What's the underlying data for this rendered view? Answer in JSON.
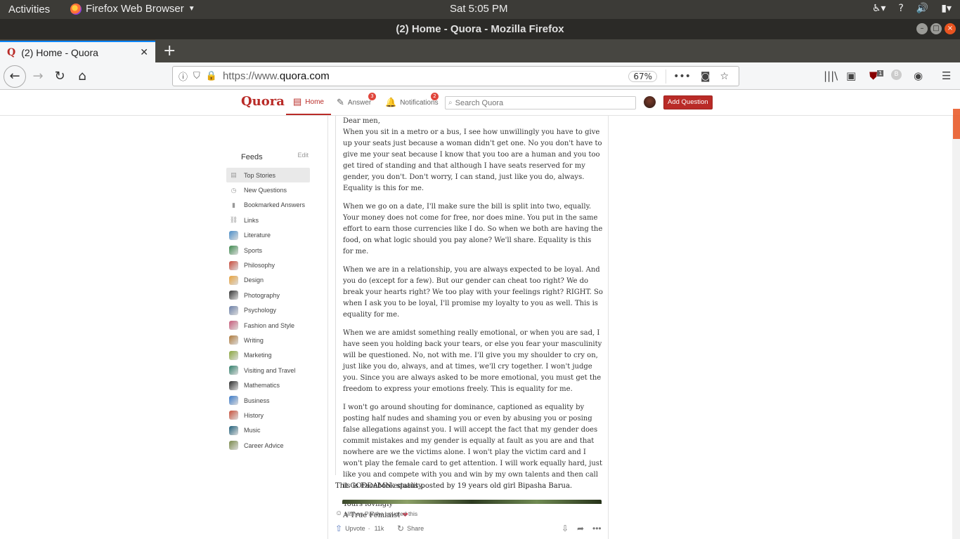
{
  "system": {
    "activities": "Activities",
    "app_name": "Firefox Web Browser",
    "clock": "Sat  5:05 PM"
  },
  "window": {
    "title": "(2) Home - Quora - Mozilla Firefox"
  },
  "tab": {
    "title": "(2) Home - Quora"
  },
  "navbar": {
    "url_prefix": "https://www.",
    "url_domain": "quora.com",
    "zoom": "67%",
    "ublock_count": "1"
  },
  "quora": {
    "logo": "Quora",
    "nav": {
      "home": "Home",
      "answer": "Answer",
      "answer_badge": "3",
      "notifications": "Notifications",
      "notifications_badge": "2"
    },
    "search_placeholder": "Search Quora",
    "add_question": "Add Question"
  },
  "feeds": {
    "title": "Feeds",
    "edit": "Edit",
    "items": [
      {
        "label": "Top Stories",
        "icon": "top-stories-icon",
        "color": "#999999"
      },
      {
        "label": "New Questions",
        "icon": "clock-icon",
        "color": "#999999"
      },
      {
        "label": "Bookmarked Answers",
        "icon": "bookmark-icon",
        "color": "#999999"
      },
      {
        "label": "Links",
        "icon": "link-icon",
        "color": "#999999"
      },
      {
        "label": "Literature",
        "icon": "topic-image",
        "color": "#4a8ec9"
      },
      {
        "label": "Sports",
        "icon": "topic-image",
        "color": "#3d8a4e"
      },
      {
        "label": "Philosophy",
        "icon": "topic-image",
        "color": "#c94a3a"
      },
      {
        "label": "Design",
        "icon": "topic-image",
        "color": "#e8a23c"
      },
      {
        "label": "Photography",
        "icon": "topic-image",
        "color": "#333333"
      },
      {
        "label": "Psychology",
        "icon": "topic-image",
        "color": "#6a7fa8"
      },
      {
        "label": "Fashion and Style",
        "icon": "topic-image",
        "color": "#c85a7a"
      },
      {
        "label": "Writing",
        "icon": "topic-image",
        "color": "#b07a3a"
      },
      {
        "label": "Marketing",
        "icon": "topic-image",
        "color": "#8aa83c"
      },
      {
        "label": "Visiting and Travel",
        "icon": "topic-image",
        "color": "#2f7f6a"
      },
      {
        "label": "Mathematics",
        "icon": "topic-image",
        "color": "#2a2a2a"
      },
      {
        "label": "Business",
        "icon": "topic-image",
        "color": "#3a7ac9"
      },
      {
        "label": "History",
        "icon": "topic-image",
        "color": "#c9503a"
      },
      {
        "label": "Music",
        "icon": "topic-image",
        "color": "#1f5f7a"
      },
      {
        "label": "Career Advice",
        "icon": "topic-image",
        "color": "#7a8a4a"
      }
    ]
  },
  "post": {
    "paragraphs": [
      "Dear men,\nWhen you sit in a metro or a bus, I see how unwillingly you have to give up your seats just because a woman didn't get one. No you don't have to give me your seat because I know that you too are a human and you too get tired of standing and that although I have seats reserved for my gender, you don't. Don't worry, I can stand, just like you do, always. Equality is this for me.",
      "When we go on a date, I'll make sure the bill is split into two, equally. Your money does not come for free, nor does mine. You put in the same effort to earn those currencies like I do. So when we both are having the food, on what logic should you pay alone? We'll share. Equality is this for me.",
      "When we are in a relationship, you are always expected to be loyal. And you do (except for a few). But our gender can cheat too right? We do break your hearts right? We too play with your feelings right? RIGHT. So when I ask you to be loyal, I'll promise my loyalty to you as well. This is equality for me.",
      "When we are amidst something really emotional, or when you are sad, I have seen you holding back your tears, or else you fear your masculinity will be questioned. No, not with me. I'll give you my shoulder to cry on, just like you do, always, and at times, we'll cry together. I won't judge you. Since you are always asked to be more emotional, you must get the freedom to express your emotions freely. This is equality for me.",
      "I won't go around shouting for dominance, captioned as equality by posting half nudes and shaming you or even by abusing you or posing false allegations against you. I will accept the fact that my gender does commit mistakes and my gender is equally at fault as you are and that nowhere are we the victims alone. I won't play the victim card and I won't play the female card to get attention. I will work equally hard, just like you and compete with you and win by my own talents and then call it GODDAMN equality."
    ],
    "signoff_1": "Yours lovingly",
    "signoff_2": "A True Feminist",
    "note": "This is Facebook status posted by 19 years old girl Bipasha Barua.",
    "upvoted_by": "Nishan Pantha upvoted this",
    "upvote_label": "Upvote",
    "upvote_sep": "·",
    "upvote_count": "11k",
    "share_label": "Share"
  }
}
